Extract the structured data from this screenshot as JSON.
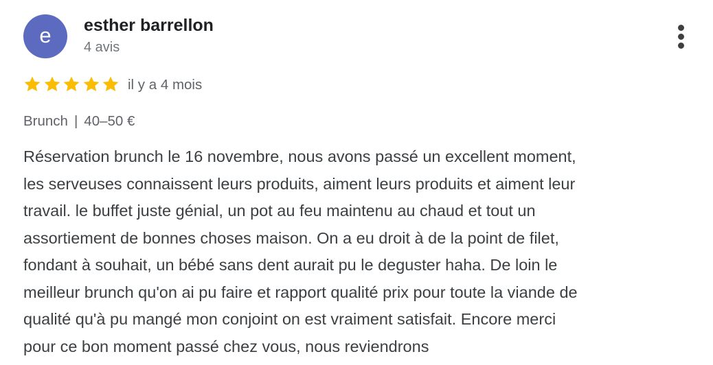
{
  "review": {
    "avatar_letter": "e",
    "avatar_color": "#5c6bc0",
    "author_name": "esther barrellon",
    "review_count": "4 avis",
    "rating": 5,
    "rating_max": 5,
    "star_color": "#fbbc04",
    "date": "il y a 4 mois",
    "meta": {
      "meal_type": "Brunch",
      "separator": "|",
      "price_range": "40–50 €"
    },
    "text_lines": [
      "Réservation brunch le 16 novembre, nous avons passé un excellent moment,",
      "les serveuses connaissent leurs produits, aiment leurs produits et aiment leur",
      "travail. le buffet juste génial, un pot au feu maintenu au chaud et tout un",
      "assortiement de bonnes choses maison. On a eu droit à de la point de filet,",
      "fondant à souhait, un bébé sans dent aurait pu le deguster haha. De loin le",
      "meilleur brunch qu'on ai pu faire et rapport qualité prix pour toute la viande de",
      "qualité qu'à pu mangé mon conjoint on est vraiment satisfait. Encore merci",
      "pour ce bon moment passé chez vous, nous reviendrons"
    ],
    "more_icon": "more-vertical-icon"
  }
}
